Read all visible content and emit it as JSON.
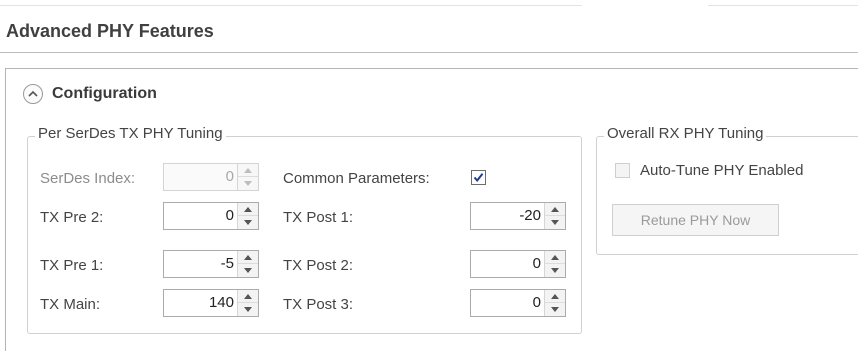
{
  "header": {
    "title": "Advanced PHY Features"
  },
  "configuration": {
    "title": "Configuration",
    "expander_icon": "chevron-up-icon",
    "tx_tuning": {
      "legend": "Per SerDes TX PHY Tuning",
      "serdes_index_label": "SerDes Index:",
      "serdes_index_value": "0",
      "common_parameters_label": "Common Parameters:",
      "common_parameters_checked": true,
      "tx_pre2_label": "TX Pre 2:",
      "tx_pre2_value": "0",
      "tx_pre1_label": "TX Pre 1:",
      "tx_pre1_value": "-5",
      "tx_main_label": "TX Main:",
      "tx_main_value": "140",
      "tx_post1_label": "TX Post 1:",
      "tx_post1_value": "-20",
      "tx_post2_label": "TX Post 2:",
      "tx_post2_value": "0",
      "tx_post3_label": "TX Post 3:",
      "tx_post3_value": "0"
    },
    "rx_tuning": {
      "legend": "Overall RX PHY Tuning",
      "auto_tune_label": "Auto-Tune PHY Enabled",
      "auto_tune_checked": false,
      "retune_button_label": "Retune PHY Now"
    }
  },
  "colors": {
    "title_text": "#404040",
    "border": "#b5b5b5",
    "checkbox_check": "#1a3d8f"
  }
}
